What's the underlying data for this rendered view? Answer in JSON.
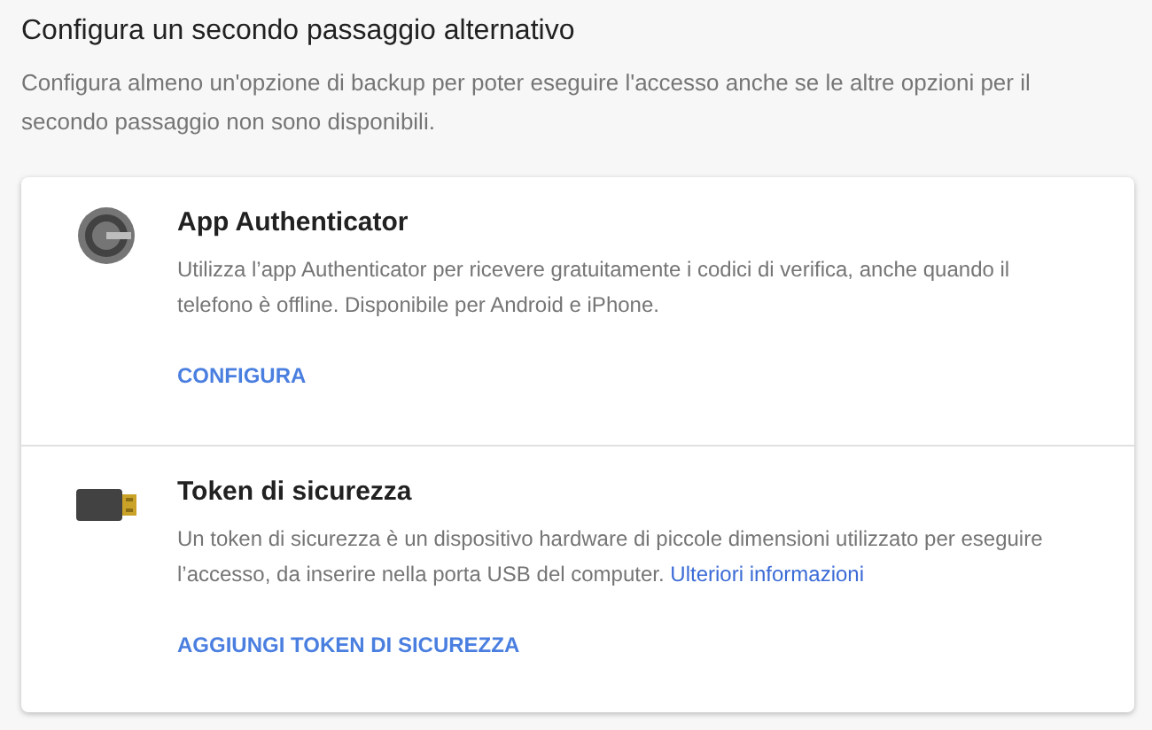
{
  "header": {
    "title": "Configura un secondo passaggio alternativo",
    "description": "Configura almeno un'opzione di backup per poter eseguire l'accesso anche se le altre opzioni per il secondo passaggio non sono disponibili."
  },
  "options": [
    {
      "kind": "authenticator",
      "title": "App Authenticator",
      "description": "Utilizza l’app Authenticator per ricevere gratuitamente i codici di verifica, anche quando il telefono è offline. Disponibile per Android e iPhone.",
      "action": "CONFIGURA"
    },
    {
      "kind": "token",
      "title": "Token di sicurezza",
      "description": "Un token di sicurezza è un dispositivo hardware di piccole dimensioni utilizzato per eseguire l’accesso, da inserire nella porta USB del computer.",
      "link": "Ulteriori informazioni",
      "action": "AGGIUNGI TOKEN DI SICUREZZA"
    }
  ]
}
